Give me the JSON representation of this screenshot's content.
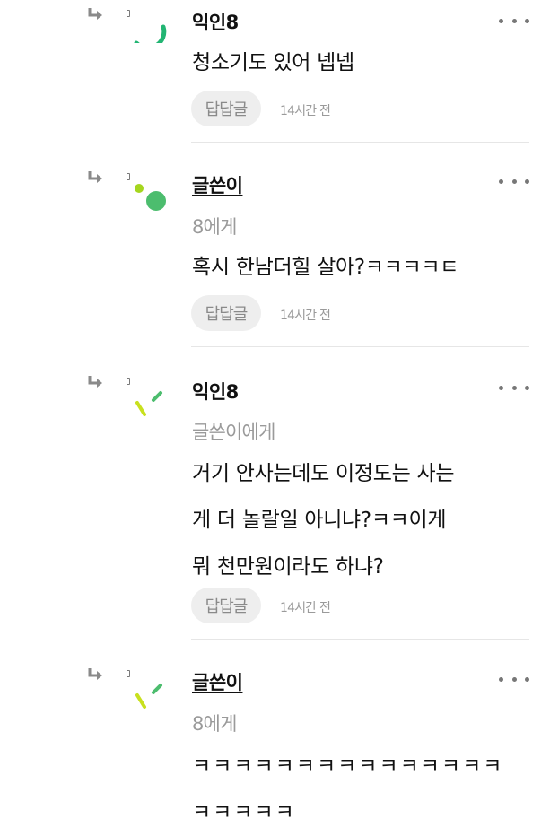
{
  "comments": [
    {
      "name": "익인8",
      "target": "",
      "text": "청소기도 있어 넵넵",
      "reply_label": "답답글",
      "time": "14시간 전"
    },
    {
      "name": "글쓴이",
      "target": "8에게",
      "text": "혹시 한남더힐 살아?ㅋㅋㅋㅋㅌ",
      "reply_label": "답답글",
      "time": "14시간 전"
    },
    {
      "name": "익인8",
      "target": "글쓴이에게",
      "text": "거기 안사는데도 이정도는 사는\n게 더 놀랄일 아니냐?ㅋㅋ이게\n뭐 천만원이라도 하냐?",
      "reply_label": "답답글",
      "time": "14시간 전"
    },
    {
      "name": "글쓴이",
      "target": "8에게",
      "text": "ㅋㅋㅋㅋㅋㅋㅋㅋㅋㅋㅋㅋㅋㅋㅋ\nㅋㅋㅋㅋㅋ"
    }
  ],
  "colors": {
    "avatar_green": "#22b573",
    "avatar_dot_green": "#4cbd6e",
    "avatar_lime": "#a5d61e",
    "avatar_yellow": "#d4e61c"
  },
  "icons": [
    "reply-arrow-icon",
    "more-options-icon",
    "avatar-icon"
  ]
}
